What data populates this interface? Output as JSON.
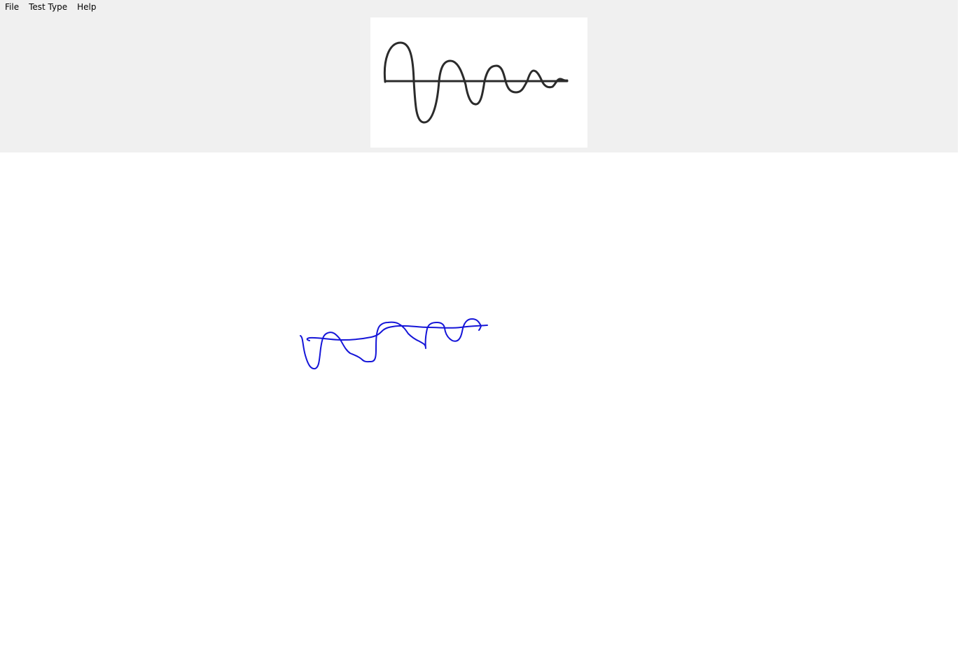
{
  "menu": {
    "items": [
      "File",
      "Test Type",
      "Help"
    ]
  },
  "colors": {
    "panel_bg": "#f0f0f0",
    "canvas_bg": "#ffffff",
    "reference_ink": "#2b2b2b",
    "user_ink": "#1515d8"
  },
  "icons": {
    "reference_pattern": "damped-sine-wave",
    "user_drawing": "freehand-stroke"
  }
}
